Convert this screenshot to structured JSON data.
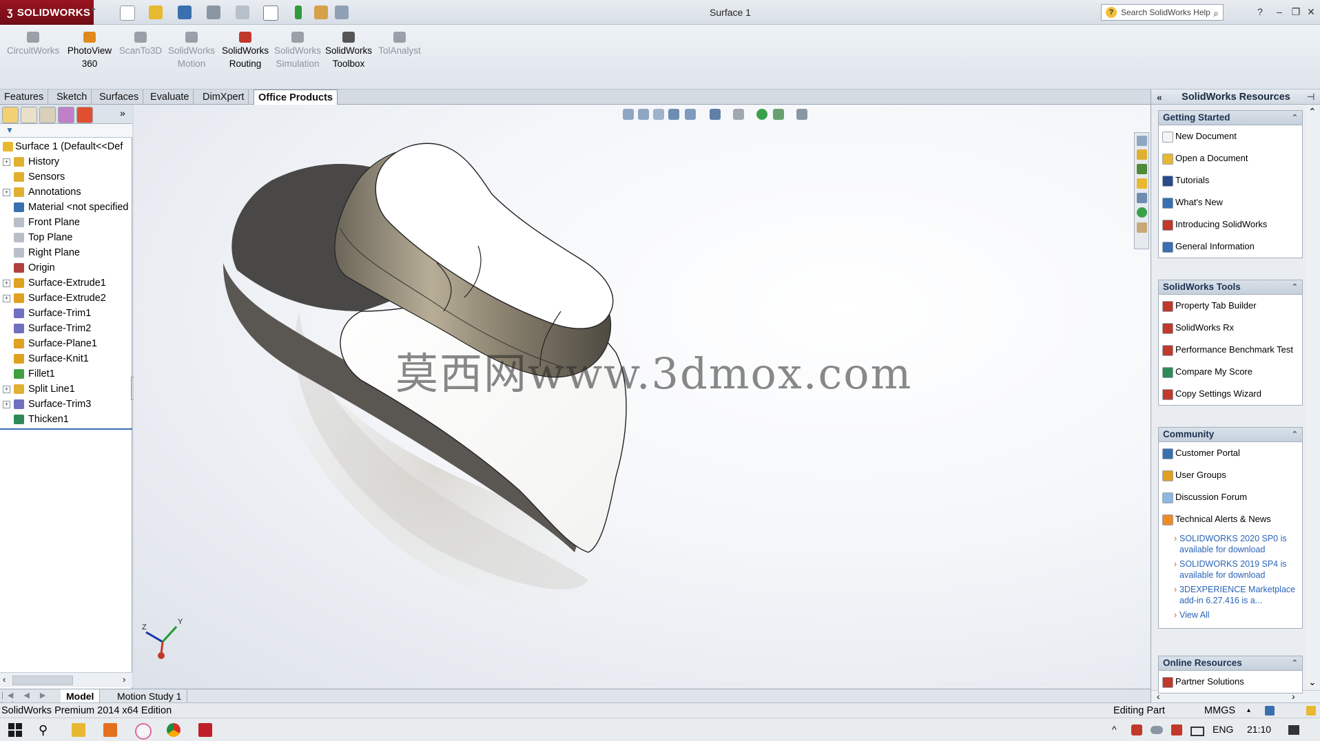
{
  "app": {
    "logo_text": "SOLIDWORKS",
    "document_title": "Surface 1",
    "help_search_placeholder": "Search SolidWorks Help"
  },
  "ribbon": {
    "buttons": [
      {
        "line1": "CircuitWorks",
        "line2": "",
        "icon": "circuitworks-icon",
        "color": "#9aa0a8",
        "enabled": false
      },
      {
        "line1": "PhotoView",
        "line2": "360",
        "icon": "photoview-icon",
        "color": "#e08a1e",
        "enabled": true
      },
      {
        "line1": "ScanTo3D",
        "line2": "",
        "icon": "scanto3d-icon",
        "color": "#9aa0a8",
        "enabled": false
      },
      {
        "line1": "SolidWorks",
        "line2": "Motion",
        "icon": "motion-icon",
        "color": "#9aa0a8",
        "enabled": false
      },
      {
        "line1": "SolidWorks",
        "line2": "Routing",
        "icon": "routing-icon",
        "color": "#c0392b",
        "enabled": true
      },
      {
        "line1": "SolidWorks",
        "line2": "Simulation",
        "icon": "simulation-icon",
        "color": "#9aa0a8",
        "enabled": false
      },
      {
        "line1": "SolidWorks",
        "line2": "Toolbox",
        "icon": "toolbox-icon",
        "color": "#555555",
        "enabled": true
      },
      {
        "line1": "TolAnalyst",
        "line2": "",
        "icon": "tolanalyst-icon",
        "color": "#9aa0a8",
        "enabled": false
      }
    ]
  },
  "command_tabs": [
    "Features",
    "Sketch",
    "Surfaces",
    "Evaluate",
    "DimXpert",
    "Office Products"
  ],
  "active_command_tab": "Office Products",
  "feature_tree": {
    "root": "Surface 1  (Default<<Def",
    "items": [
      {
        "label": "History",
        "expandable": true,
        "icon_color": "#e0b030"
      },
      {
        "label": "Sensors",
        "expandable": false,
        "icon_color": "#e0b030"
      },
      {
        "label": "Annotations",
        "expandable": true,
        "icon_color": "#e0b030"
      },
      {
        "label": "Material <not specified",
        "expandable": false,
        "icon_color": "#3a6fb0"
      },
      {
        "label": "Front Plane",
        "expandable": false,
        "icon_color": "#b9bfc8"
      },
      {
        "label": "Top Plane",
        "expandable": false,
        "icon_color": "#b9bfc8"
      },
      {
        "label": "Right Plane",
        "expandable": false,
        "icon_color": "#b9bfc8"
      },
      {
        "label": "Origin",
        "expandable": false,
        "icon_color": "#b04040"
      },
      {
        "label": "Surface-Extrude1",
        "expandable": true,
        "icon_color": "#e0a020"
      },
      {
        "label": "Surface-Extrude2",
        "expandable": true,
        "icon_color": "#e0a020"
      },
      {
        "label": "Surface-Trim1",
        "expandable": false,
        "icon_color": "#7070c0"
      },
      {
        "label": "Surface-Trim2",
        "expandable": false,
        "icon_color": "#7070c0"
      },
      {
        "label": "Surface-Plane1",
        "expandable": false,
        "icon_color": "#e0a020"
      },
      {
        "label": "Surface-Knit1",
        "expandable": false,
        "icon_color": "#e0a020"
      },
      {
        "label": "Fillet1",
        "expandable": false,
        "icon_color": "#40a040"
      },
      {
        "label": "Split Line1",
        "expandable": true,
        "icon_color": "#e0b030"
      },
      {
        "label": "Surface-Trim3",
        "expandable": true,
        "icon_color": "#7070c0"
      },
      {
        "label": "Thicken1",
        "expandable": false,
        "icon_color": "#2e8b57"
      }
    ]
  },
  "graphics": {
    "watermark": "莫西网www.3dmox.com",
    "triad_labels": {
      "z": "Z",
      "y": "Y"
    }
  },
  "bottom_tabs": [
    "Model",
    "Motion Study 1"
  ],
  "active_bottom_tab": "Model",
  "status_bar": {
    "edition": "SolidWorks Premium 2014 x64 Edition",
    "mode": "Editing Part",
    "units": "MMGS"
  },
  "task_pane": {
    "title": "SolidWorks Resources",
    "sections": [
      {
        "title": "Getting Started",
        "links": [
          {
            "label": "New Document",
            "icon": "new-document-icon",
            "color": "#f4f4f4"
          },
          {
            "label": "Open a Document",
            "icon": "open-document-icon",
            "color": "#e8b830"
          },
          {
            "label": "Tutorials",
            "icon": "tutorials-icon",
            "color": "#2a4a8a"
          },
          {
            "label": "What's New",
            "icon": "whats-new-icon",
            "color": "#3a6fb0"
          },
          {
            "label": "Introducing SolidWorks",
            "icon": "introducing-icon",
            "color": "#c0392b"
          },
          {
            "label": "General Information",
            "icon": "info-icon",
            "color": "#3a6fb0"
          }
        ]
      },
      {
        "title": "SolidWorks Tools",
        "links": [
          {
            "label": "Property Tab Builder",
            "icon": "property-tab-builder-icon",
            "color": "#c0392b"
          },
          {
            "label": "SolidWorks Rx",
            "icon": "solidworks-rx-icon",
            "color": "#c0392b"
          },
          {
            "label": "Performance Benchmark Test",
            "icon": "benchmark-icon",
            "color": "#c0392b"
          },
          {
            "label": "Compare My Score",
            "icon": "compare-score-icon",
            "color": "#2e8b57"
          },
          {
            "label": "Copy Settings Wizard",
            "icon": "copy-settings-icon",
            "color": "#c0392b"
          }
        ]
      },
      {
        "title": "Community",
        "links": [
          {
            "label": "Customer Portal",
            "icon": "customer-portal-icon",
            "color": "#3a6fb0"
          },
          {
            "label": "User Groups",
            "icon": "user-groups-icon",
            "color": "#e0a020"
          },
          {
            "label": "Discussion Forum",
            "icon": "forum-icon",
            "color": "#8fb6e0"
          },
          {
            "label": "Technical Alerts & News",
            "icon": "rss-icon",
            "color": "#f08a24"
          }
        ],
        "news": [
          "SOLIDWORKS 2020 SP0 is available for download",
          "SOLIDWORKS 2019 SP4 is available for download",
          "3DEXPERIENCE Marketplace add-in 6.27.416 is a...",
          "View All"
        ]
      },
      {
        "title": "Online Resources",
        "links": [
          {
            "label": "Partner Solutions",
            "icon": "partner-solutions-icon",
            "color": "#c0392b"
          }
        ]
      }
    ]
  },
  "taskbar": {
    "language": "ENG",
    "time": "21:10"
  }
}
